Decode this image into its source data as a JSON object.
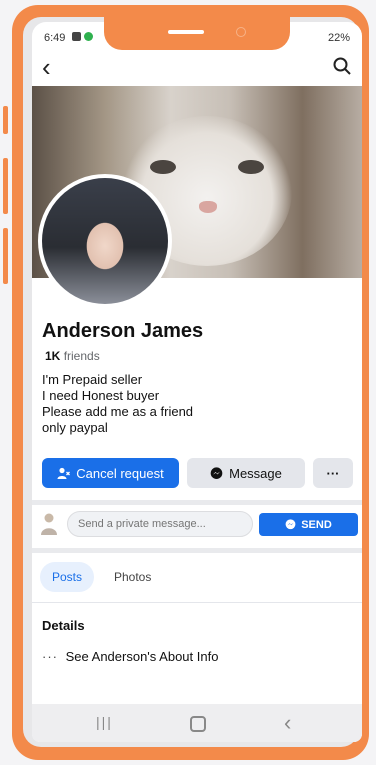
{
  "status_bar": {
    "time": "6:49",
    "battery": "22%"
  },
  "profile": {
    "name": "Anderson James",
    "friends_count": "1K",
    "friends_label": "friends",
    "bio": [
      "I'm Prepaid seller",
      "I need Honest buyer",
      "Please add me as a friend",
      "only paypal"
    ]
  },
  "actions": {
    "cancel_request": "Cancel request",
    "message": "Message",
    "more": "···"
  },
  "private_message": {
    "placeholder": "Send a private message...",
    "send_label": "SEND"
  },
  "tabs": [
    {
      "label": "Posts",
      "active": true
    },
    {
      "label": "Photos",
      "active": false
    }
  ],
  "details": {
    "heading": "Details",
    "about_dots": "···",
    "about_link": "See Anderson's About Info"
  },
  "icons": {
    "back": "chevron-left-icon",
    "search": "search-icon",
    "cancel_request": "person-cancel-icon",
    "message": "messenger-icon",
    "send": "messenger-icon",
    "nav_recents": "recents-icon",
    "nav_home": "home-icon",
    "nav_back": "back-icon"
  },
  "colors": {
    "frame": "#f38a4a",
    "primary": "#1a6fe8",
    "secondary_button": "#e4e6eb"
  }
}
